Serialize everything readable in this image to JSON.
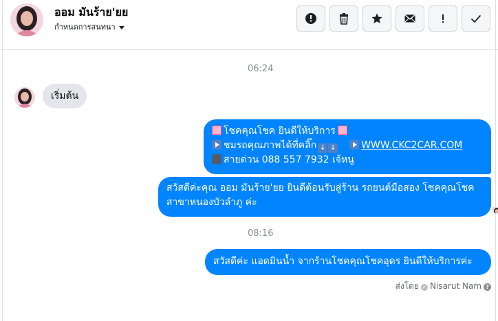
{
  "contact": {
    "name": "ออม มันร้าย'ยย",
    "subtitle": "กำหนดการสนทนา"
  },
  "toolbar": [
    {
      "name": "mark-spam-button",
      "icon": "alert-circle-icon"
    },
    {
      "name": "delete-button",
      "icon": "trash-icon"
    },
    {
      "name": "star-button",
      "icon": "star-icon"
    },
    {
      "name": "mark-unread-button",
      "icon": "envelope-icon"
    },
    {
      "name": "important-button",
      "icon": "exclamation-icon"
    },
    {
      "name": "mark-done-button",
      "icon": "checkmark-icon"
    }
  ],
  "conversation": {
    "time_1": "06:24",
    "incoming_message": "เริ่มต้น",
    "outgoing_1": {
      "line_1": "โชคคุณโชค ยินดีให้บริการ",
      "line_2_text": "ชมรถคุณภาพได้ที่คลิ๊ก",
      "line_2_link": "WWW.CKC2CAR.COM",
      "line_3": "สายด่วน 088 557 7932 เจ้หนู"
    },
    "outgoing_2": "สวัสดีค่ะคุณ ออม มันร้าย'ยย ยินดีต้อนรับสู่ร้าน รถยนต์มือสอง โชคคุณโชค สาขาหนองบัวลำภู ค่ะ",
    "time_2": "08:16",
    "outgoing_3": "สวัสดีค่ะ แอดมินน้ำ จากร้านโชคคุณโชคอุดร ยินดีให้บริการค่ะ",
    "sent_by_label": "ส่งโดย",
    "sent_by_name": "Nisarut Nam"
  },
  "colors": {
    "outgoing_bubble": "#0084ff",
    "incoming_bubble": "#e4e6eb",
    "timestamp": "#8a8d91"
  }
}
